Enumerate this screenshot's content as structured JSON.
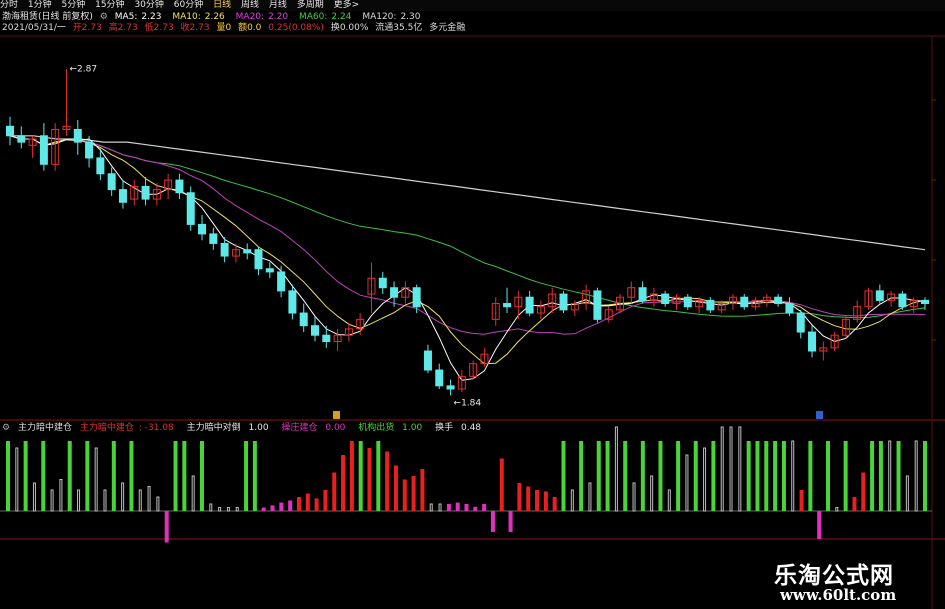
{
  "toolbar": {
    "tabs": [
      "分时",
      "1分钟",
      "5分钟",
      "15分钟",
      "30分钟",
      "60分钟",
      "日线",
      "周线",
      "月线",
      "多周期",
      "更多>"
    ]
  },
  "stock_title": "渤海租赁(日线 前复权)",
  "ma": {
    "ma5": {
      "label": "MA5:",
      "value": "2.23",
      "color": "#ffffff"
    },
    "ma10": {
      "label": "MA10:",
      "value": "2.26",
      "color": "#f0e060"
    },
    "ma20": {
      "label": "MA20:",
      "value": "2.20",
      "color": "#e040e0"
    },
    "ma60": {
      "label": "MA60:",
      "value": "2.24",
      "color": "#40d040"
    },
    "ma120": {
      "label": "MA120:",
      "value": "2.30",
      "color": "#d8d8d8"
    }
  },
  "info": {
    "date": "2021/05/31/一",
    "open": "开2.73",
    "high": "高2.73",
    "low": "低2.73",
    "close": "收2.73",
    "volume": "量0",
    "amount": "额0.0",
    "change": "0.25(0.08%)",
    "turnover": "换0.00%",
    "float": "流通35.5亿",
    "extra": "多元金融"
  },
  "price_labels": {
    "high": "2.87",
    "low": "1.84"
  },
  "indicator": {
    "name": "主力暗中建仓",
    "v1_label": "主力暗中建仓",
    "v1_value": "-31.08",
    "v2_label": "主力暗中对倒",
    "v2_value": "1.00",
    "v3_label": "操庄建仓",
    "v3_value": "0.00",
    "v4_label": "机构出货",
    "v4_value": "1.00",
    "v5_label": "换手",
    "v5_value": "0.48"
  },
  "watermark": {
    "cn": "乐淘公式网",
    "url": "www.60lt.com"
  },
  "colors": {
    "up": "#e23030",
    "down": "#5ee8e8",
    "ma5": "#ffffff",
    "ma10": "#f0e060",
    "ma20": "#c040c0",
    "ma60": "#40c040",
    "ma120": "#d0d0d0",
    "green_bar": "#49d43a",
    "red_bar": "#e82020",
    "magenta_bar": "#e030c0",
    "grey_bar": "#bfbfbf"
  },
  "chart_data": {
    "type": "candlestick",
    "ylim": [
      1.8,
      2.95
    ],
    "candles": [
      {
        "o": 2.69,
        "h": 2.72,
        "l": 2.63,
        "c": 2.66
      },
      {
        "o": 2.66,
        "h": 2.69,
        "l": 2.62,
        "c": 2.64
      },
      {
        "o": 2.63,
        "h": 2.66,
        "l": 2.59,
        "c": 2.65
      },
      {
        "o": 2.66,
        "h": 2.7,
        "l": 2.55,
        "c": 2.57
      },
      {
        "o": 2.57,
        "h": 2.7,
        "l": 2.55,
        "c": 2.68
      },
      {
        "o": 2.68,
        "h": 2.87,
        "l": 2.66,
        "c": 2.69
      },
      {
        "o": 2.68,
        "h": 2.71,
        "l": 2.6,
        "c": 2.64
      },
      {
        "o": 2.64,
        "h": 2.66,
        "l": 2.56,
        "c": 2.59
      },
      {
        "o": 2.59,
        "h": 2.62,
        "l": 2.52,
        "c": 2.54
      },
      {
        "o": 2.54,
        "h": 2.56,
        "l": 2.47,
        "c": 2.49
      },
      {
        "o": 2.49,
        "h": 2.52,
        "l": 2.43,
        "c": 2.45
      },
      {
        "o": 2.46,
        "h": 2.52,
        "l": 2.44,
        "c": 2.5
      },
      {
        "o": 2.5,
        "h": 2.53,
        "l": 2.44,
        "c": 2.46
      },
      {
        "o": 2.46,
        "h": 2.51,
        "l": 2.44,
        "c": 2.49
      },
      {
        "o": 2.49,
        "h": 2.54,
        "l": 2.46,
        "c": 2.52
      },
      {
        "o": 2.52,
        "h": 2.54,
        "l": 2.46,
        "c": 2.48
      },
      {
        "o": 2.48,
        "h": 2.5,
        "l": 2.36,
        "c": 2.38
      },
      {
        "o": 2.38,
        "h": 2.41,
        "l": 2.33,
        "c": 2.35
      },
      {
        "o": 2.35,
        "h": 2.37,
        "l": 2.3,
        "c": 2.32
      },
      {
        "o": 2.32,
        "h": 2.34,
        "l": 2.26,
        "c": 2.28
      },
      {
        "o": 2.28,
        "h": 2.32,
        "l": 2.26,
        "c": 2.3
      },
      {
        "o": 2.3,
        "h": 2.32,
        "l": 2.27,
        "c": 2.29
      },
      {
        "o": 2.3,
        "h": 2.31,
        "l": 2.22,
        "c": 2.24
      },
      {
        "o": 2.24,
        "h": 2.26,
        "l": 2.21,
        "c": 2.23
      },
      {
        "o": 2.23,
        "h": 2.25,
        "l": 2.15,
        "c": 2.17
      },
      {
        "o": 2.17,
        "h": 2.19,
        "l": 2.08,
        "c": 2.1
      },
      {
        "o": 2.1,
        "h": 2.13,
        "l": 2.04,
        "c": 2.06
      },
      {
        "o": 2.06,
        "h": 2.09,
        "l": 2.01,
        "c": 2.03
      },
      {
        "o": 2.03,
        "h": 2.06,
        "l": 1.99,
        "c": 2.01
      },
      {
        "o": 2.01,
        "h": 2.05,
        "l": 1.98,
        "c": 2.03
      },
      {
        "o": 2.03,
        "h": 2.07,
        "l": 2.01,
        "c": 2.05
      },
      {
        "o": 2.05,
        "h": 2.1,
        "l": 2.03,
        "c": 2.08
      },
      {
        "o": 2.16,
        "h": 2.26,
        "l": 2.1,
        "c": 2.21
      },
      {
        "o": 2.21,
        "h": 2.23,
        "l": 2.16,
        "c": 2.18
      },
      {
        "o": 2.18,
        "h": 2.2,
        "l": 2.12,
        "c": 2.15
      },
      {
        "o": 2.15,
        "h": 2.2,
        "l": 2.13,
        "c": 2.18
      },
      {
        "o": 2.18,
        "h": 2.19,
        "l": 2.1,
        "c": 2.12
      },
      {
        "o": 1.98,
        "h": 2.0,
        "l": 1.91,
        "c": 1.92
      },
      {
        "o": 1.92,
        "h": 1.94,
        "l": 1.86,
        "c": 1.87
      },
      {
        "o": 1.87,
        "h": 1.89,
        "l": 1.84,
        "c": 1.86
      },
      {
        "o": 1.86,
        "h": 1.92,
        "l": 1.85,
        "c": 1.9
      },
      {
        "o": 1.9,
        "h": 1.95,
        "l": 1.89,
        "c": 1.94
      },
      {
        "o": 1.94,
        "h": 1.99,
        "l": 1.93,
        "c": 1.97
      },
      {
        "o": 2.08,
        "h": 2.15,
        "l": 2.06,
        "c": 2.13
      },
      {
        "o": 2.13,
        "h": 2.18,
        "l": 2.1,
        "c": 2.12
      },
      {
        "o": 2.12,
        "h": 2.17,
        "l": 2.08,
        "c": 2.15
      },
      {
        "o": 2.15,
        "h": 2.17,
        "l": 2.09,
        "c": 2.1
      },
      {
        "o": 2.1,
        "h": 2.14,
        "l": 2.08,
        "c": 2.12
      },
      {
        "o": 2.12,
        "h": 2.18,
        "l": 2.1,
        "c": 2.16
      },
      {
        "o": 2.16,
        "h": 2.17,
        "l": 2.1,
        "c": 2.11
      },
      {
        "o": 2.11,
        "h": 2.14,
        "l": 2.09,
        "c": 2.13
      },
      {
        "o": 2.13,
        "h": 2.19,
        "l": 2.11,
        "c": 2.17
      },
      {
        "o": 2.17,
        "h": 2.18,
        "l": 2.07,
        "c": 2.08
      },
      {
        "o": 2.08,
        "h": 2.12,
        "l": 2.07,
        "c": 2.11
      },
      {
        "o": 2.11,
        "h": 2.16,
        "l": 2.1,
        "c": 2.15
      },
      {
        "o": 2.15,
        "h": 2.2,
        "l": 2.13,
        "c": 2.18
      },
      {
        "o": 2.18,
        "h": 2.2,
        "l": 2.13,
        "c": 2.14
      },
      {
        "o": 2.14,
        "h": 2.18,
        "l": 2.12,
        "c": 2.16
      },
      {
        "o": 2.16,
        "h": 2.17,
        "l": 2.12,
        "c": 2.13
      },
      {
        "o": 2.13,
        "h": 2.16,
        "l": 2.11,
        "c": 2.15
      },
      {
        "o": 2.15,
        "h": 2.16,
        "l": 2.11,
        "c": 2.12
      },
      {
        "o": 2.12,
        "h": 2.15,
        "l": 2.1,
        "c": 2.14
      },
      {
        "o": 2.14,
        "h": 2.15,
        "l": 2.1,
        "c": 2.11
      },
      {
        "o": 2.11,
        "h": 2.14,
        "l": 2.1,
        "c": 2.13
      },
      {
        "o": 2.13,
        "h": 2.16,
        "l": 2.11,
        "c": 2.15
      },
      {
        "o": 2.15,
        "h": 2.16,
        "l": 2.11,
        "c": 2.12
      },
      {
        "o": 2.12,
        "h": 2.15,
        "l": 2.11,
        "c": 2.14
      },
      {
        "o": 2.14,
        "h": 2.16,
        "l": 2.12,
        "c": 2.15
      },
      {
        "o": 2.15,
        "h": 2.16,
        "l": 2.12,
        "c": 2.13
      },
      {
        "o": 2.13,
        "h": 2.15,
        "l": 2.09,
        "c": 2.1
      },
      {
        "o": 2.1,
        "h": 2.11,
        "l": 2.02,
        "c": 2.04
      },
      {
        "o": 2.04,
        "h": 2.06,
        "l": 1.96,
        "c": 1.98
      },
      {
        "o": 1.98,
        "h": 2.01,
        "l": 1.95,
        "c": 1.99
      },
      {
        "o": 1.99,
        "h": 2.04,
        "l": 1.98,
        "c": 2.03
      },
      {
        "o": 2.03,
        "h": 2.09,
        "l": 2.02,
        "c": 2.08
      },
      {
        "o": 2.08,
        "h": 2.14,
        "l": 2.07,
        "c": 2.12
      },
      {
        "o": 2.12,
        "h": 2.18,
        "l": 2.11,
        "c": 2.17
      },
      {
        "o": 2.17,
        "h": 2.19,
        "l": 2.13,
        "c": 2.14
      },
      {
        "o": 2.14,
        "h": 2.17,
        "l": 2.12,
        "c": 2.16
      },
      {
        "o": 2.16,
        "h": 2.17,
        "l": 2.11,
        "c": 2.12
      },
      {
        "o": 2.12,
        "h": 2.15,
        "l": 2.1,
        "c": 2.14
      },
      {
        "o": 2.14,
        "h": 2.15,
        "l": 2.11,
        "c": 2.13
      }
    ],
    "ma120": [
      2.66,
      2.66,
      2.65,
      2.65,
      2.64,
      2.64,
      2.63,
      2.62,
      2.61,
      2.6,
      2.59,
      2.58,
      2.57,
      2.56,
      2.55,
      2.54,
      2.53,
      2.52,
      2.51,
      2.5,
      2.49,
      2.48,
      2.47,
      2.46,
      2.45,
      2.44,
      2.43,
      2.42,
      2.41,
      2.4,
      2.39,
      2.38,
      2.37,
      2.36,
      2.35,
      2.34,
      2.33,
      2.32,
      2.31,
      2.3
    ]
  },
  "indicator_data": {
    "bars": [
      {
        "t": "g",
        "v": 1.0
      },
      {
        "t": "w",
        "v": 0.9
      },
      {
        "t": "g",
        "v": 1.0
      },
      {
        "t": "w",
        "v": 0.4
      },
      {
        "t": "g",
        "v": 1.0
      },
      {
        "t": "w",
        "v": 0.3
      },
      {
        "t": "w",
        "v": 0.45
      },
      {
        "t": "g",
        "v": 1.0
      },
      {
        "t": "w",
        "v": 0.3
      },
      {
        "t": "g",
        "v": 1.0
      },
      {
        "t": "w",
        "v": 0.9
      },
      {
        "t": "w",
        "v": 0.3
      },
      {
        "t": "g",
        "v": 1.0
      },
      {
        "t": "w",
        "v": 0.4
      },
      {
        "t": "g",
        "v": 1.0
      },
      {
        "t": "w",
        "v": 0.3
      },
      {
        "t": "w",
        "v": 0.35
      },
      {
        "t": "w",
        "v": 0.2
      },
      {
        "t": "m",
        "v": -0.45
      },
      {
        "t": "g",
        "v": 1.0
      },
      {
        "t": "g",
        "v": 1.0
      },
      {
        "t": "w",
        "v": 0.5
      },
      {
        "t": "g",
        "v": 1.0
      },
      {
        "t": "w",
        "v": 0.1
      },
      {
        "t": "w",
        "v": 0.05
      },
      {
        "t": "w",
        "v": 0.05
      },
      {
        "t": "w",
        "v": 0.05
      },
      {
        "t": "g",
        "v": 1.0
      },
      {
        "t": "g",
        "v": 1.0
      },
      {
        "t": "m",
        "v": 0.05
      },
      {
        "t": "m",
        "v": 0.08
      },
      {
        "t": "m",
        "v": 0.12
      },
      {
        "t": "m",
        "v": 0.15
      },
      {
        "t": "r",
        "v": 0.2
      },
      {
        "t": "r",
        "v": 0.25
      },
      {
        "t": "r",
        "v": 0.18
      },
      {
        "t": "r",
        "v": 0.3
      },
      {
        "t": "r",
        "v": 0.55
      },
      {
        "t": "r",
        "v": 0.8
      },
      {
        "t": "r",
        "v": 1.0
      },
      {
        "t": "g",
        "v": 1.0
      },
      {
        "t": "r",
        "v": 0.9
      },
      {
        "t": "g",
        "v": 1.0
      },
      {
        "t": "r",
        "v": 0.85
      },
      {
        "t": "r",
        "v": 0.65
      },
      {
        "t": "r",
        "v": 0.45
      },
      {
        "t": "r",
        "v": 0.5
      },
      {
        "t": "r",
        "v": 0.6
      },
      {
        "t": "w",
        "v": 0.1
      },
      {
        "t": "w",
        "v": 0.1
      },
      {
        "t": "m",
        "v": 0.1
      },
      {
        "t": "m",
        "v": 0.12
      },
      {
        "t": "m",
        "v": 0.1
      },
      {
        "t": "m",
        "v": 0.06
      },
      {
        "t": "m",
        "v": 0.1
      },
      {
        "t": "m",
        "v": -0.3
      },
      {
        "t": "r",
        "v": 0.75
      },
      {
        "t": "m",
        "v": -0.3
      },
      {
        "t": "r",
        "v": 0.4
      },
      {
        "t": "r",
        "v": 0.35
      },
      {
        "t": "r",
        "v": 0.3
      },
      {
        "t": "r",
        "v": 0.28
      },
      {
        "t": "r",
        "v": 0.2
      },
      {
        "t": "g",
        "v": 1.0
      },
      {
        "t": "w",
        "v": 0.3
      },
      {
        "t": "g",
        "v": 1.0
      },
      {
        "t": "w",
        "v": 0.4
      },
      {
        "t": "g",
        "v": 1.0
      },
      {
        "t": "g",
        "v": 1.0
      },
      {
        "t": "w",
        "v": 1.2
      },
      {
        "t": "g",
        "v": 1.0
      },
      {
        "t": "w",
        "v": 0.4
      },
      {
        "t": "g",
        "v": 1.0
      },
      {
        "t": "w",
        "v": 0.5
      },
      {
        "t": "g",
        "v": 1.0
      },
      {
        "t": "w",
        "v": 0.3
      },
      {
        "t": "g",
        "v": 1.0
      },
      {
        "t": "w",
        "v": 0.8
      },
      {
        "t": "g",
        "v": 1.0
      },
      {
        "t": "w",
        "v": 0.9
      },
      {
        "t": "g",
        "v": 1.0
      },
      {
        "t": "w",
        "v": 1.2
      },
      {
        "t": "w",
        "v": 1.2
      },
      {
        "t": "w",
        "v": 1.2
      },
      {
        "t": "g",
        "v": 1.0
      },
      {
        "t": "g",
        "v": 1.0
      },
      {
        "t": "g",
        "v": 1.0
      },
      {
        "t": "g",
        "v": 1.0
      },
      {
        "t": "g",
        "v": 1.0
      },
      {
        "t": "w",
        "v": 1.0
      },
      {
        "t": "r",
        "v": 0.3
      },
      {
        "t": "g",
        "v": 1.0
      },
      {
        "t": "m",
        "v": -0.4
      },
      {
        "t": "g",
        "v": 1.0
      },
      {
        "t": "w",
        "v": 0.05
      },
      {
        "t": "g",
        "v": 1.0
      },
      {
        "t": "r",
        "v": 0.2
      },
      {
        "t": "r",
        "v": 0.55
      },
      {
        "t": "g",
        "v": 1.0
      },
      {
        "t": "g",
        "v": 1.0
      },
      {
        "t": "w",
        "v": 1.0
      },
      {
        "t": "g",
        "v": 1.0
      },
      {
        "t": "w",
        "v": 0.5
      },
      {
        "t": "w",
        "v": 1.0
      },
      {
        "t": "g",
        "v": 1.0
      }
    ]
  }
}
